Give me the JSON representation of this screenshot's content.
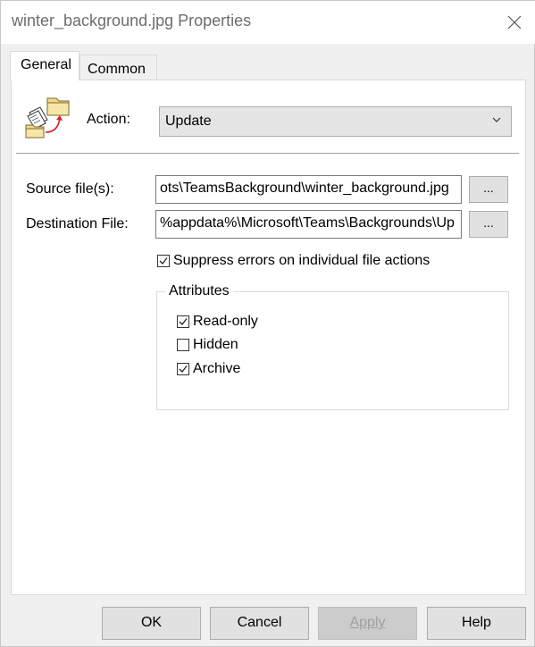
{
  "window": {
    "title": "winter_background.jpg Properties"
  },
  "tabs": [
    {
      "label": "General"
    },
    {
      "label": "Common"
    }
  ],
  "action": {
    "label": "Action:",
    "selected": "Update"
  },
  "source": {
    "label": "Source file(s):",
    "value": "ots\\TeamsBackground\\winter_background.jpg",
    "browse_label": "..."
  },
  "destination": {
    "label": "Destination File:",
    "value": "%appdata%\\Microsoft\\Teams\\Backgrounds\\Up",
    "browse_label": "..."
  },
  "suppress_errors": {
    "label": "Suppress errors on individual file actions",
    "checked": true
  },
  "attributes": {
    "title": "Attributes",
    "items": [
      {
        "label": "Read-only",
        "checked": true
      },
      {
        "label": "Hidden",
        "checked": false
      },
      {
        "label": "Archive",
        "checked": true
      }
    ]
  },
  "buttons": {
    "ok": "OK",
    "cancel": "Cancel",
    "apply": "Apply",
    "help": "Help"
  },
  "colors": {
    "titlebar": "#ffffff",
    "dialog_bg": "#f0f0f0",
    "disabled_text": "#a0a0a0"
  }
}
